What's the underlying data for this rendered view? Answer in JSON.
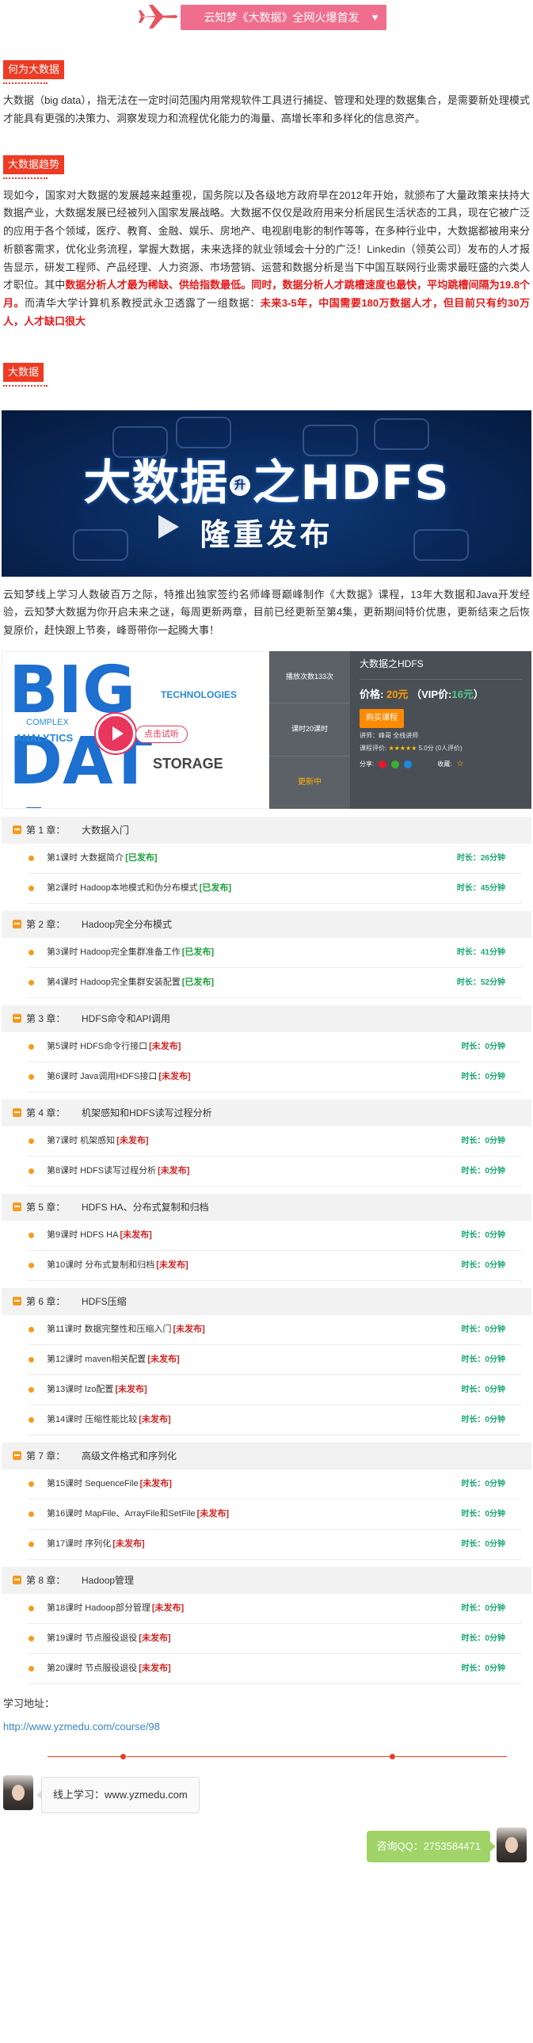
{
  "banner": {
    "title": "云知梦《大数据》全网火爆首发",
    "heart": "♥"
  },
  "sections": {
    "what_tag": "何为大数据",
    "what_text": "大数据（big data），指无法在一定时间范围内用常规软件工具进行捕捉、管理和处理的数据集合，是需要新处理模式才能具有更强的决策力、洞察发现力和流程优化能力的海量、高增长率和多样化的信息资产。",
    "trend_tag": "大数据趋势",
    "trend_text_1": "现如今，国家对大数据的发展越来越重视，国务院以及各级地方政府早在2012年开始，就颁布了大量政策来扶持大数据产业，大数据发展已经被列入国家发展战略。大数据不仅仅是政府用来分析居民生活状态的工具，现在它被广泛的应用于各个领域，医疗、教育、金融、娱乐、房地产、电视剧电影的制作等等，在多种行业中，大数据都被用来分析额客需求，优化业务流程，掌握大数据，未来选择的就业领域会十分的广泛！Linkedin（领英公司）发布的人才报告显示，研发工程师、产品经理、人力资源、市场营销、运营和数据分析是当下中国互联网行业需求最旺盛的六类人才职位。其中",
    "trend_text_red_1": "数据分析人才最为稀缺、供给指数最低。同时，数据分析人才跳槽速度也最快，平均跳槽间隔为19.8个月。",
    "trend_text_2": "而清华大学计算机系教授武永卫透露了一组数据：",
    "trend_text_red_2": "未来3-5年，中国需要180万数据人才，但目前只有约30万人，人才缺口很大",
    "bigdata_tag": "大数据",
    "intro_text": "云知梦线上学习人数破百万之际，特推出独家签约名师峰哥巅峰制作《大数据》课程，13年大数据和Java开发经验，云知梦大数据为你开启未来之谜，每周更新两章，目前已经更新至第4集，更新期间特价优惠，更新结束之后恢复原价，赶快跟上节奏，峰哥带你一起腾大事！"
  },
  "poster": {
    "title_a": "大数据",
    "title_dot": "升",
    "title_b": "之HDFS",
    "subtitle": "隆重发布"
  },
  "course": {
    "thumb_big": "BIG DATA",
    "thumb_words": [
      "COMPLEX",
      "ANALYTICS",
      "TECHNOLOGIES",
      "STORAGE"
    ],
    "try_label": "点击试听",
    "views": "播放次数133次",
    "duration": "课时20课时",
    "update": "更新中",
    "name": "大数据之HDFS",
    "price_label": "价格:",
    "price": "20元",
    "vip_label": "VIP价:",
    "vip_price": "16元",
    "vip_close": "）",
    "vip_open": "（",
    "buy": "购买课程",
    "teacher": "讲师：峰哥  全栈讲师",
    "rating_label": "课程评价:",
    "stars": "★★★★★",
    "rating_count": "5.0分 (0人评价)",
    "share": "分享:",
    "fav": "收藏:"
  },
  "chapters": [
    {
      "label": "第 1 章：",
      "title": "大数据入门",
      "lessons": [
        {
          "name": "第1课时 大数据简介",
          "status": "[已发布]",
          "pub": true,
          "dur": "时长：26分钟"
        },
        {
          "name": "第2课时 Hadoop本地模式和伪分布模式",
          "status": "[已发布]",
          "pub": true,
          "dur": "时长：45分钟"
        }
      ]
    },
    {
      "label": "第 2 章：",
      "title": "Hadoop完全分布模式",
      "lessons": [
        {
          "name": "第3课时 Hadoop完全集群准备工作",
          "status": "[已发布]",
          "pub": true,
          "dur": "时长：41分钟"
        },
        {
          "name": "第4课时 Hadoop完全集群安装配置",
          "status": "[已发布]",
          "pub": true,
          "dur": "时长：52分钟"
        }
      ]
    },
    {
      "label": "第 3 章：",
      "title": "HDFS命令和API调用",
      "lessons": [
        {
          "name": "第5课时 HDFS命令行接口",
          "status": "[未发布]",
          "pub": false,
          "dur": "时长：0分钟"
        },
        {
          "name": "第6课时 Java调用HDFS接口",
          "status": "[未发布]",
          "pub": false,
          "dur": "时长：0分钟"
        }
      ]
    },
    {
      "label": "第 4 章：",
      "title": "机架感知和HDFS读写过程分析",
      "lessons": [
        {
          "name": "第7课时 机架感知",
          "status": "[未发布]",
          "pub": false,
          "dur": "时长：0分钟"
        },
        {
          "name": "第8课时 HDFS读写过程分析",
          "status": "[未发布]",
          "pub": false,
          "dur": "时长：0分钟"
        }
      ]
    },
    {
      "label": "第 5 章：",
      "title": "HDFS HA、分布式复制和归档",
      "lessons": [
        {
          "name": "第9课时 HDFS HA",
          "status": "[未发布]",
          "pub": false,
          "dur": "时长：0分钟"
        },
        {
          "name": "第10课时 分布式复制和归档",
          "status": "[未发布]",
          "pub": false,
          "dur": "时长：0分钟"
        }
      ]
    },
    {
      "label": "第 6 章：",
      "title": "HDFS压缩",
      "lessons": [
        {
          "name": "第11课时 数据完整性和压缩入门",
          "status": "[未发布]",
          "pub": false,
          "dur": "时长：0分钟"
        },
        {
          "name": "第12课时 maven相关配置",
          "status": "[未发布]",
          "pub": false,
          "dur": "时长：0分钟"
        },
        {
          "name": "第13课时 lzo配置",
          "status": "[未发布]",
          "pub": false,
          "dur": "时长：0分钟"
        },
        {
          "name": "第14课时 压缩性能比较",
          "status": "[未发布]",
          "pub": false,
          "dur": "时长：0分钟"
        }
      ]
    },
    {
      "label": "第 7 章：",
      "title": "高级文件格式和序列化",
      "lessons": [
        {
          "name": "第15课时 SequenceFile",
          "status": "[未发布]",
          "pub": false,
          "dur": "时长：0分钟"
        },
        {
          "name": "第16课时 MapFile、ArrayFile和SetFile",
          "status": "[未发布]",
          "pub": false,
          "dur": "时长：0分钟"
        },
        {
          "name": "第17课时 序列化",
          "status": "[未发布]",
          "pub": false,
          "dur": "时长：0分钟"
        }
      ]
    },
    {
      "label": "第 8 章：",
      "title": "Hadoop管理",
      "lessons": [
        {
          "name": "第18课时 Hadoop部分管理",
          "status": "[未发布]",
          "pub": false,
          "dur": "时长：0分钟"
        },
        {
          "name": "第19课时 节点服役退役",
          "status": "[未发布]",
          "pub": false,
          "dur": "时长：0分钟"
        },
        {
          "name": "第20课时 节点服役退役",
          "status": "[未发布]",
          "pub": false,
          "dur": "时长：0分钟"
        }
      ]
    }
  ],
  "footer": {
    "learn_label": "学习地址：",
    "link": "http://www.yzmedu.com/course/98",
    "online": "线上学习：www.yzmedu.com",
    "qq": "咨询QQ：2753584471"
  },
  "colors": {
    "accent": "#ee3b24",
    "pink": "#f06e8d",
    "green": "#18a873",
    "orange": "#f59b1e"
  }
}
